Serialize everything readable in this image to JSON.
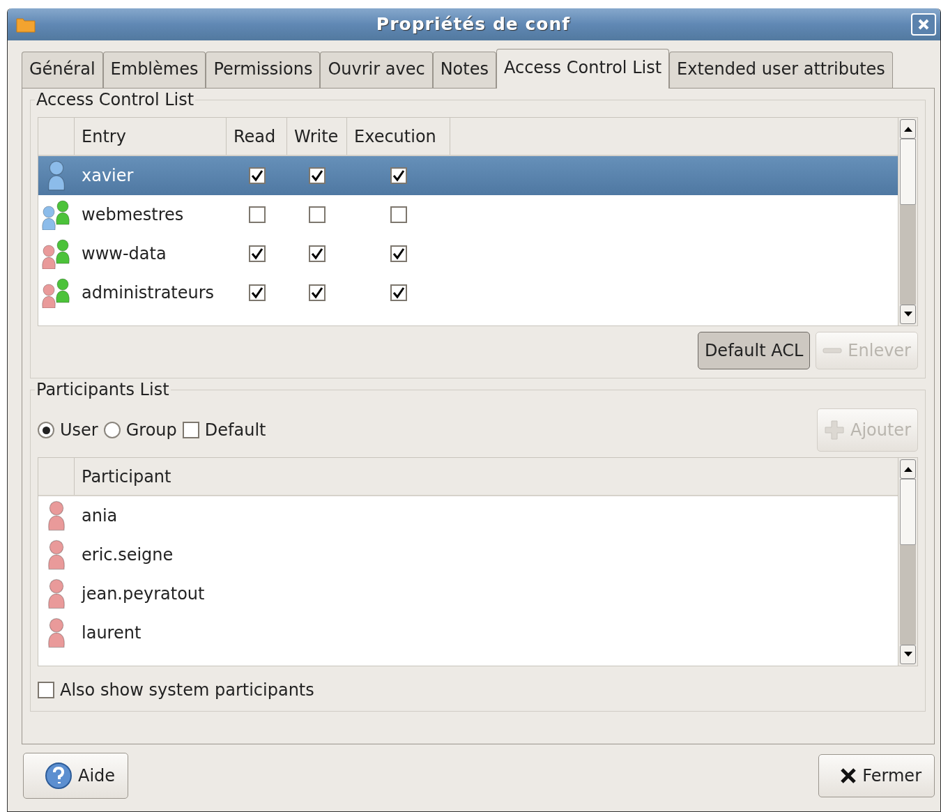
{
  "window": {
    "title": "Propriétés de conf"
  },
  "tabs": [
    {
      "label": "Général",
      "selected": false
    },
    {
      "label": "Emblèmes",
      "selected": false
    },
    {
      "label": "Permissions",
      "selected": false
    },
    {
      "label": "Ouvrir avec",
      "selected": false
    },
    {
      "label": "Notes",
      "selected": false
    },
    {
      "label": "Access Control List",
      "selected": true
    },
    {
      "label": "Extended user attributes",
      "selected": false
    }
  ],
  "acl": {
    "title": "Access Control List",
    "columns": [
      "Entry",
      "Read",
      "Write",
      "Execution"
    ],
    "rows": [
      {
        "kind": "user",
        "color": "#8cbcea",
        "name": "xavier",
        "read": true,
        "write": true,
        "execution": true,
        "selected": true
      },
      {
        "kind": "group",
        "color": "#8cbcea",
        "name": "webmestres",
        "read": false,
        "write": false,
        "execution": false,
        "selected": false
      },
      {
        "kind": "group",
        "color": "#e99a9a",
        "name": "www-data",
        "read": true,
        "write": true,
        "execution": true,
        "selected": false
      },
      {
        "kind": "group",
        "color": "#e99a9a",
        "name": "administrateurs",
        "read": true,
        "write": true,
        "execution": true,
        "selected": false
      }
    ],
    "buttons": [
      {
        "kind": "toggle",
        "label": "Default ACL",
        "pressed": true,
        "disabled": false
      },
      {
        "kind": "remove",
        "label": "Enlever",
        "pressed": false,
        "disabled": true
      }
    ]
  },
  "participants": {
    "title": "Participants List",
    "filters": [
      {
        "kind": "radio",
        "label": "User",
        "checked": true
      },
      {
        "kind": "radio",
        "label": "Group",
        "checked": false
      },
      {
        "kind": "checkbox",
        "label": "Default",
        "checked": false
      }
    ],
    "add_button": {
      "label": "Ajouter",
      "disabled": true
    },
    "column": "Participant",
    "rows": [
      {
        "name": "ania",
        "color": "#e99a9a"
      },
      {
        "name": "eric.seigne",
        "color": "#e99a9a"
      },
      {
        "name": "jean.peyratout",
        "color": "#e99a9a"
      },
      {
        "name": "laurent",
        "color": "#e99a9a"
      }
    ],
    "system_option": {
      "label": "Also show system participants",
      "checked": false
    }
  },
  "footer": [
    {
      "kind": "help",
      "label": "Aide"
    },
    {
      "kind": "close",
      "label": "Fermer"
    }
  ]
}
